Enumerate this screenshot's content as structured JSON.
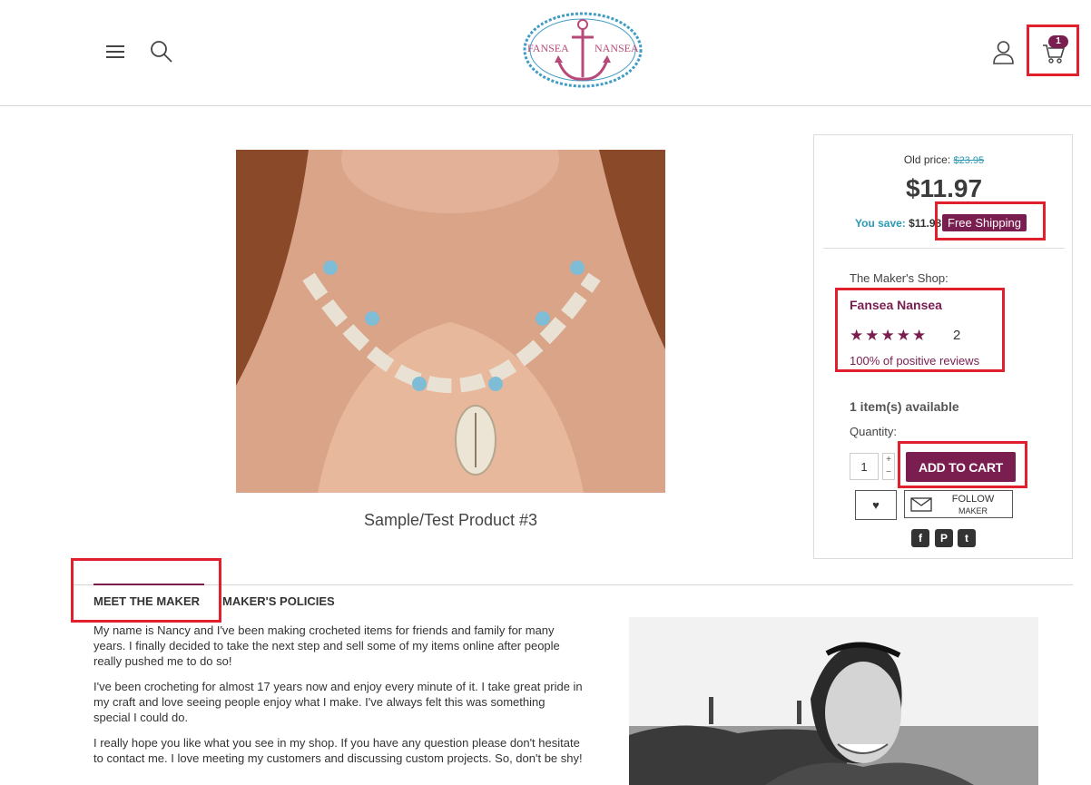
{
  "header": {
    "logo_text_left": "FANSEA",
    "logo_text_right": "NANSEA",
    "cart_count": "1",
    "icons": [
      "hamburger-icon",
      "search-icon",
      "user-icon",
      "cart-icon"
    ]
  },
  "product": {
    "title": "Sample/Test Product #3",
    "image_alt": "shell-necklace-photo"
  },
  "pricing": {
    "old_price_label": "Old price:",
    "old_price": "$23.95",
    "price": "$11.97",
    "save_label": "You save:",
    "save_amount": "$11.98",
    "free_shipping": "Free Shipping"
  },
  "maker": {
    "shop_label": "The Maker's Shop:",
    "shop_name": "Fansea Nansea",
    "rating": 5,
    "stars": "★★★★★",
    "review_count": "2",
    "positive_reviews": "100% of positive reviews"
  },
  "purchase": {
    "availability": "1 item(s) available",
    "quantity_label": "Quantity:",
    "quantity_value": "1",
    "step_up": "+",
    "step_down": "−",
    "add_to_cart": "ADD TO CART",
    "wishlist_icon": "heart-icon",
    "follow_line1": "FOLLOW",
    "follow_line2": "MAKER",
    "social": {
      "facebook": "f",
      "pinterest": "P",
      "twitter": "t"
    }
  },
  "tabs": [
    {
      "label": "MEET THE MAKER",
      "active": true
    },
    {
      "label": "MAKER'S POLICIES",
      "active": false
    }
  ],
  "about": {
    "p1": "My name is Nancy and I've been making crocheted items for friends and family for many years. I finally decided to take the next step and sell some of my items online after people really pushed me to do so!",
    "p2": "I've been crocheting for almost 17 years now and enjoy every minute of it. I take great pride in my craft and love seeing people enjoy what I make. I've always felt this was something special I could do.",
    "p3": "I really hope you like what you see in my shop. If you have any question please don't hesitate to contact me. I love meeting my customers and discussing custom projects. So, don't be shy!"
  },
  "colors": {
    "accent": "#7a1d4f",
    "teal": "#2a9ab2",
    "highlight": "#e0212d"
  }
}
